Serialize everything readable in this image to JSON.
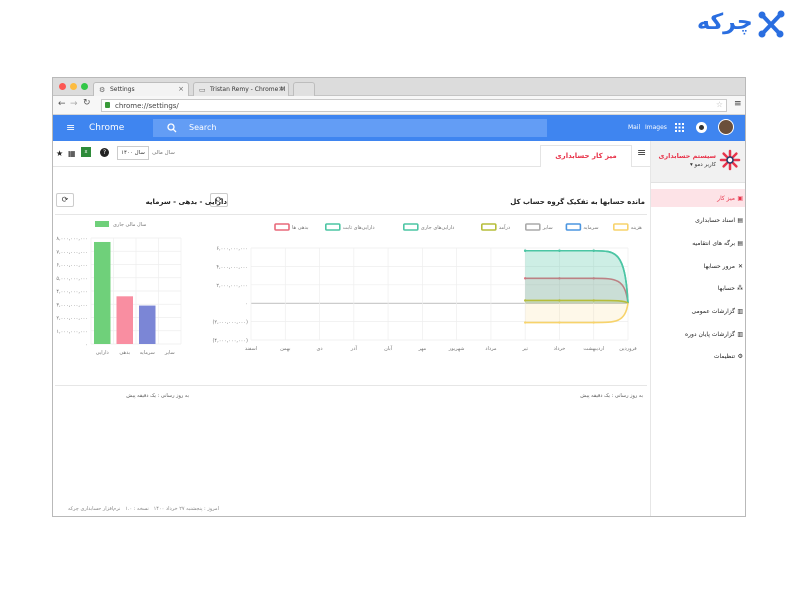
{
  "logo": {
    "text": "چرکه"
  },
  "browser": {
    "tabs": [
      {
        "label": "Settings",
        "icon": "gear-icon"
      },
      {
        "label": "Tristan Remy - Chrome M",
        "icon": "page-icon"
      }
    ],
    "url": "chrome://settings/",
    "window_colors": [
      "#fc5753",
      "#fdbc40",
      "#33c748"
    ]
  },
  "appbar": {
    "title": "Chrome",
    "search_placeholder": "Search",
    "links": [
      "Mail",
      "Images"
    ],
    "color": "#3f85f0"
  },
  "toolbar": {
    "fiscal_year_label": "سال مالی",
    "fiscal_year_value": "سال ۱۴۰۰",
    "page_title": "میز کار حسابداری",
    "accent": "#e8334a"
  },
  "sidebar": {
    "brand_title": "سیستم حسابداری",
    "user": "کاربر دمو",
    "items": [
      {
        "label": "میز کار",
        "icon": "desk-icon",
        "active": true
      },
      {
        "label": "اسناد حسابداری",
        "icon": "document-icon"
      },
      {
        "label": "برگه های انتقامیه",
        "icon": "file-icon"
      },
      {
        "label": "مرور حسابها",
        "icon": "shuffle-icon"
      },
      {
        "label": "حسابها",
        "icon": "sitemap-icon"
      },
      {
        "label": "گزارشات عمومی",
        "icon": "chart-icon"
      },
      {
        "label": "گزارشات پایان دوره",
        "icon": "chart-icon"
      },
      {
        "label": "تنظیمات",
        "icon": "gear-icon"
      }
    ]
  },
  "panels": {
    "right_title": "مانده حسابها به تفکیک گروه حساب کل",
    "left_title": "دارایی - بدهی - سرمایه",
    "right_footer": "به روز رسانی : یک دقیقه پیش",
    "left_footer": "به روز رسانی : یک دقیقه پیش"
  },
  "footer": {
    "version": "نسخه : ۱.۰",
    "today_label": "امروز : پنجشنبه ۲۷ خرداد ۱۴۰۰",
    "company": "نرم‌افزار حسابداری چرکه"
  },
  "chart_data": [
    {
      "type": "area",
      "categories": [
        "فروردین",
        "اردیبهشت",
        "خرداد",
        "تیر",
        "مرداد",
        "شهریور",
        "مهر",
        "آبان",
        "آذر",
        "دی",
        "بهمن",
        "اسفند"
      ],
      "yticks": [
        "۶,۰۰۰,۰۰۰,۰۰۰",
        "۴,۰۰۰,۰۰۰,۰۰۰",
        "۲,۰۰۰,۰۰۰,۰۰۰",
        "۰",
        "(۲,۰۰۰,۰۰۰,۰۰۰)",
        "(۴,۰۰۰,۰۰۰,۰۰۰)"
      ],
      "ylim": [
        -4000000000,
        6000000000
      ],
      "series": [
        {
          "name": "بدهی ها",
          "color": "#e8697a",
          "values": [
            0,
            2700000000,
            2700000000,
            2700000000
          ]
        },
        {
          "name": "دارایی‌های ثابت",
          "color": "#4cc5a4",
          "values": [
            0,
            5700000000,
            5700000000,
            5700000000
          ]
        },
        {
          "name": "دارایی‌های جاری",
          "color": "#4cc5a4",
          "values": [
            0,
            5700000000,
            5700000000,
            5700000000
          ]
        },
        {
          "name": "درآمد",
          "color": "#b6bd3a",
          "values": [
            0,
            300000000,
            300000000,
            300000000
          ]
        },
        {
          "name": "سایر",
          "color": "#aaaaaa",
          "values": [
            0,
            0,
            0,
            0
          ]
        },
        {
          "name": "سرمایه",
          "color": "#4c96e0",
          "values": [
            0,
            0,
            0,
            0
          ]
        },
        {
          "name": "هزینه",
          "color": "#f7d36b",
          "values": [
            0,
            -2100000000,
            -2100000000,
            -2100000000
          ]
        }
      ]
    },
    {
      "type": "bar",
      "categories": [
        "دارایی",
        "بدهی",
        "سرمایه",
        "سایر"
      ],
      "values": [
        7700000000,
        3600000000,
        2900000000,
        0
      ],
      "colors": [
        "#6fd07a",
        "#f98ea1",
        "#7b86d6",
        "#cccccc"
      ],
      "legend": "سال مالی جاری",
      "ylim": [
        0,
        8000000000
      ],
      "yticks": [
        "۸,۰۰۰,۰۰۰,۰۰۰",
        "۷,۰۰۰,۰۰۰,۰۰۰",
        "۶,۰۰۰,۰۰۰,۰۰۰",
        "۵,۰۰۰,۰۰۰,۰۰۰",
        "۴,۰۰۰,۰۰۰,۰۰۰",
        "۳,۰۰۰,۰۰۰,۰۰۰",
        "۲,۰۰۰,۰۰۰,۰۰۰",
        "۱,۰۰۰,۰۰۰,۰۰۰",
        "۰"
      ]
    }
  ]
}
